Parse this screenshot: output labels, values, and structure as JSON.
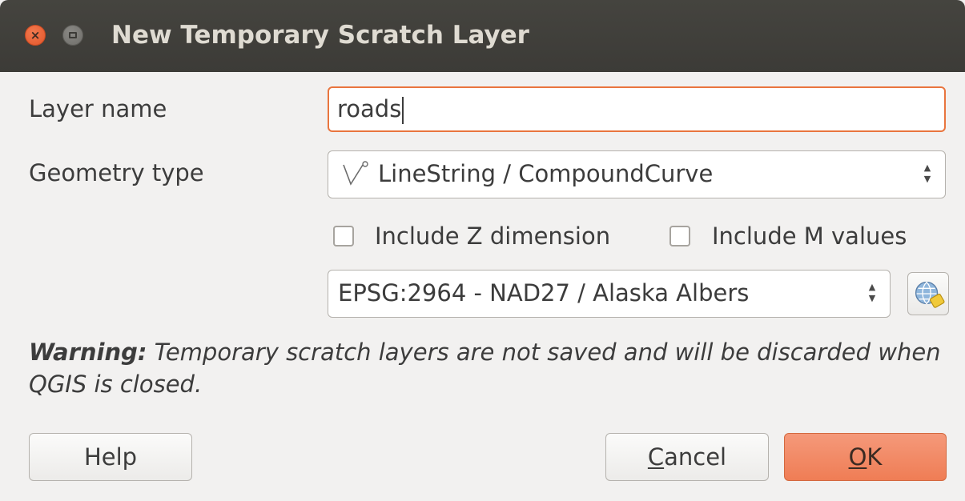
{
  "window": {
    "title": "New Temporary Scratch Layer",
    "close_glyph": "×"
  },
  "form": {
    "layer_name_label": "Layer name",
    "layer_name_value": "roads",
    "geometry_type_label": "Geometry type",
    "geometry_type_value": "LineString / CompoundCurve",
    "geometry_icon": "linestring-icon",
    "include_z_label": "Include Z dimension",
    "include_z_checked": false,
    "include_m_label": "Include M values",
    "include_m_checked": false,
    "crs_value": "EPSG:2964 - NAD27 / Alaska Albers",
    "crs_button_icon": "globe-icon"
  },
  "warning": {
    "bold": "Warning:",
    "text": " Temporary scratch layers are not saved and will be discarded when QGIS is closed."
  },
  "buttons": {
    "help": "Help",
    "cancel_first": "C",
    "cancel_rest": "ancel",
    "ok_first": "O",
    "ok_rest": "K"
  },
  "colors": {
    "titlebar": "#3c3b37",
    "accent": "#ef7d55",
    "focus_border": "#e9753e"
  }
}
